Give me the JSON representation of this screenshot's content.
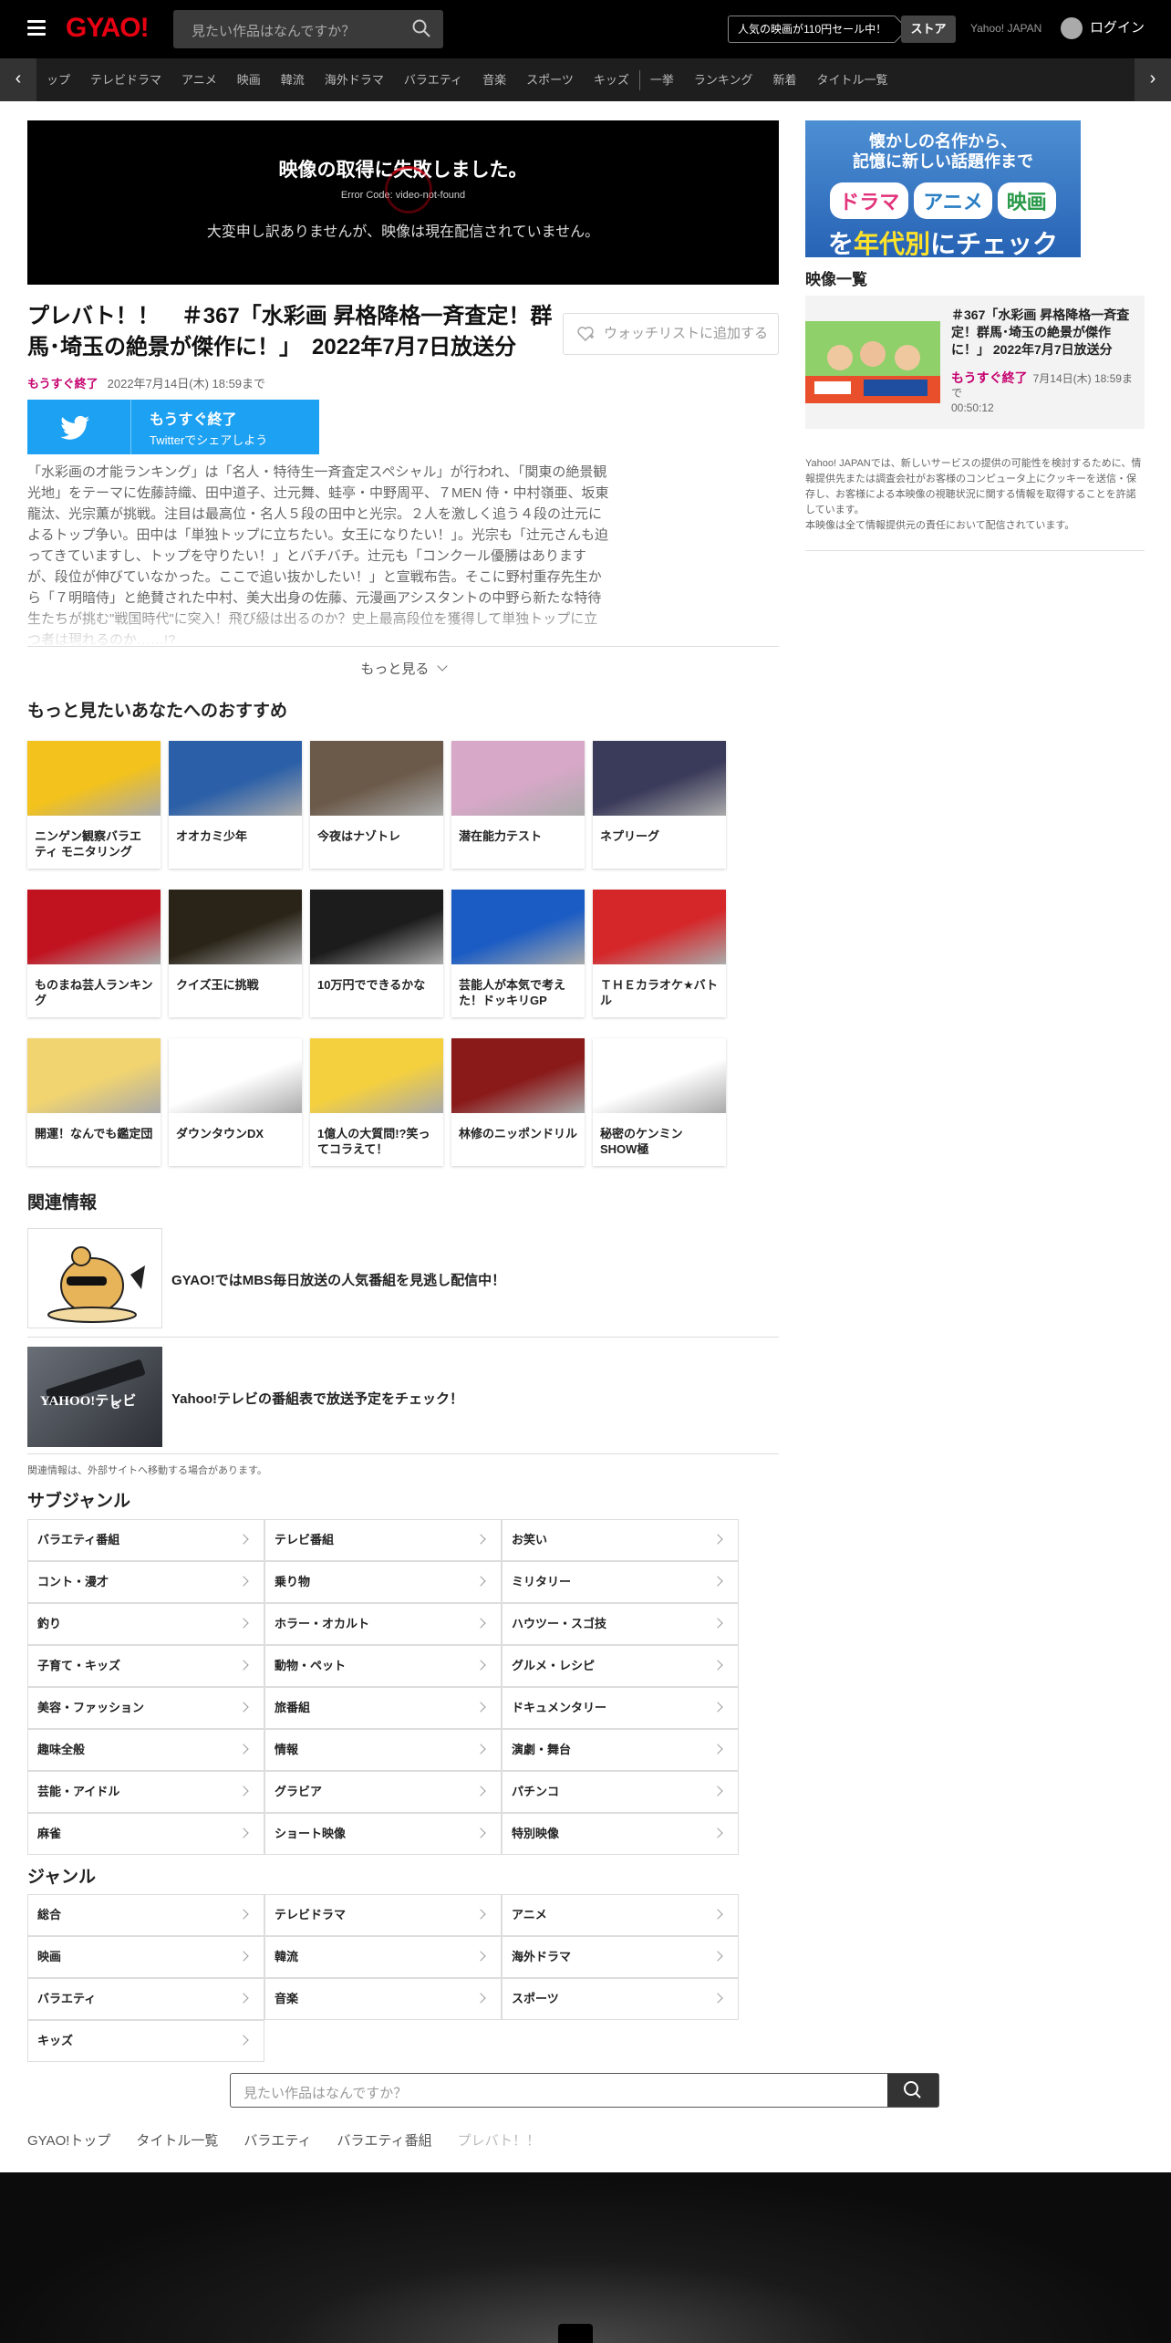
{
  "header": {
    "logo": "GYAO!",
    "search_placeholder": "見たい作品はなんですか？",
    "promo": "人気の映画が110円セール中！",
    "store": "ストア",
    "yahoo_link": "Yahoo! JAPAN",
    "login": "ログイン"
  },
  "nav": {
    "items": [
      "ップ",
      "テレビドラマ",
      "アニメ",
      "映画",
      "韓流",
      "海外ドラマ",
      "バラエティ",
      "音楽",
      "スポーツ",
      "キッズ"
    ],
    "items2": [
      "一挙",
      "ランキング",
      "新着",
      "タイトル一覧"
    ]
  },
  "player": {
    "error_title": "映像の取得に失敗しました。",
    "error_code": "Error Code: video-not-found",
    "message": "大変申し訳ありませんが、映像は現在配信されていません。"
  },
  "episode": {
    "title": "プレバト！！　＃367「水彩画 昇格降格一斉査定！群馬･埼玉の絶景が傑作に！」　2022年7月7日放送分",
    "watchlist": "ウォッチリストに追加する",
    "badge": "もうすぐ終了",
    "until": "2022年7月14日(木) 18:59まで",
    "twitter_line1": "もうすぐ終了",
    "twitter_line2": "Twitterでシェアしよう",
    "description": "「水彩画の才能ランキング」は「名人・特待生一斉査定スペシャル」が行われ、「関東の絶景観光地」をテーマに佐藤詩織、田中道子、辻元舞、蛙亭・中野周平、７MEN 侍・中村嶺亜、坂東龍汰、光宗薫が挑戦。注目は最高位・名人５段の田中と光宗。２人を激しく追う４段の辻元によるトップ争い。田中は「単独トップに立ちたい。女王になりたい！」。光宗も「辻元さんも迫ってきていますし、トップを守りたい！」とバチバチ。辻元も「コンクール優勝はありますが、段位が伸びていなかった。ここで追い抜かしたい！」と宣戦布告。そこに野村重存先生から「７明暗侍」と絶賛された中村、美大出身の佐藤、元漫画アシスタントの中野ら新たな特待生たちが挑む\"戦国時代\"に突入！飛び級は出るのか？史上最高段位を獲得して単独トップに立つ者は現れるのか……!?",
    "more": "もっと見る"
  },
  "recommend": {
    "heading": "もっと見たいあなたへのおすすめ",
    "items": [
      {
        "title": "ニンゲン観察バラエティ モニタリング",
        "color": "#f3c21c"
      },
      {
        "title": "オオカミ少年",
        "color": "#2b5fa8"
      },
      {
        "title": "今夜はナゾトレ",
        "color": "#6b5a4a"
      },
      {
        "title": "潜在能力テスト",
        "color": "#d8a8c8"
      },
      {
        "title": "ネプリーグ",
        "color": "#3a3a5a"
      },
      {
        "title": "ものまね芸人ランキング",
        "color": "#c1121f"
      },
      {
        "title": "クイズ王に挑戦",
        "color": "#2a2418"
      },
      {
        "title": "10万円でできるかな",
        "color": "#1c1c1c"
      },
      {
        "title": "芸能人が本気で考えた！ドッキリGP",
        "color": "#1b5cc4"
      },
      {
        "title": "ＴＨＥカラオケ★バトル",
        "color": "#d5272a"
      },
      {
        "title": "開運！なんでも鑑定団",
        "color": "#f1d470"
      },
      {
        "title": "ダウンタウンDX",
        "color": "#ffffff"
      },
      {
        "title": "1億人の大質問!?笑ってコラえて！",
        "color": "#f4d03f"
      },
      {
        "title": "林修のニッポンドリル",
        "color": "#8a1a1a"
      },
      {
        "title": "秘密のケンミンSHOW極",
        "color": "#ffffff"
      }
    ]
  },
  "related": {
    "heading": "関連情報",
    "items": [
      {
        "text": "GYAO!ではMBS毎日放送の人気番組を見逃し配信中！"
      },
      {
        "text": "Yahoo!テレビの番組表で放送予定をチェック！"
      }
    ],
    "note": "関連情報は、外部サイトへ移動する場合があります。"
  },
  "subgenre": {
    "heading": "サブジャンル",
    "items": [
      "バラエティ番組",
      "テレビ番組",
      "お笑い",
      "コント・漫才",
      "乗り物",
      "ミリタリー",
      "釣り",
      "ホラー・オカルト",
      "ハウツー・スゴ技",
      "子育て・キッズ",
      "動物・ペット",
      "グルメ・レシピ",
      "美容・ファッション",
      "旅番組",
      "ドキュメンタリー",
      "趣味全般",
      "情報",
      "演劇・舞台",
      "芸能・アイドル",
      "グラビア",
      "パチンコ",
      "麻雀",
      "ショート映像",
      "特別映像"
    ]
  },
  "genre": {
    "heading": "ジャンル",
    "items": [
      "総合",
      "テレビドラマ",
      "アニメ",
      "映画",
      "韓流",
      "海外ドラマ",
      "バラエティ",
      "音楽",
      "スポーツ",
      "キッズ"
    ]
  },
  "bottom_search": {
    "placeholder": "見たい作品はなんですか？"
  },
  "breadcrumb": [
    "GYAO!トップ",
    "タイトル一覧",
    "バラエティ",
    "バラエティ番組",
    "プレバト！！"
  ],
  "sidebar": {
    "banner": {
      "line1": "懐かしの名作から、",
      "line2": "記憶に新しい話題作まで",
      "pills": [
        "ドラマ",
        "アニメ",
        "映画"
      ],
      "line3a": "を",
      "line3b": "年代別",
      "line3c": "にチェック"
    },
    "video_list_heading": "映像一覧",
    "video": {
      "title": "＃367「水彩画 昇格降格一斉査定！群馬･埼玉の絶景が傑作に！」 2022年7月7日放送分",
      "badge": "もうすぐ終了",
      "until": "7月14日(木) 18:59まで",
      "duration": "00:50:12"
    },
    "note": "Yahoo! JAPANでは、新しいサービスの提供の可能性を検討するために、情報提供先または調査会社がお客様のコンピュータ上にクッキーを送信・保存し、お客様による本映像の視聴状況に関する情報を取得することを許諾しています。\n本映像は全て情報提供元の責任において配信されています。"
  },
  "colors": {
    "accent": "#c5006e",
    "brand": "#e60012",
    "twitter": "#1da1f2"
  }
}
